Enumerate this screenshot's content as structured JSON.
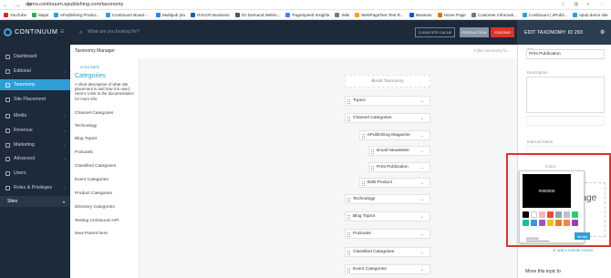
{
  "browser": {
    "url": "demo.continuum.epublishing.com/taxonomy"
  },
  "bookmarks": [
    {
      "label": "YouTube",
      "color": "#e62117"
    },
    {
      "label": "Maps",
      "color": "#34a853"
    },
    {
      "label": "ePublishing Produc...",
      "color": "#2f9ed6"
    },
    {
      "label": "Continuum Board -...",
      "color": "#2f9ed6"
    },
    {
      "label": "Multipub jira",
      "color": "#2684ff"
    },
    {
      "label": "HVACR Business",
      "color": "#1d5fa3"
    },
    {
      "label": "On Demand Webin...",
      "color": "#555"
    },
    {
      "label": "PageSpeed Insights",
      "color": "#4285f4"
    },
    {
      "label": "Wiki",
      "color": "#777"
    },
    {
      "label": "WebPageTest Test R...",
      "color": "#f4a11b"
    },
    {
      "label": "Measure",
      "color": "#0b57d0"
    },
    {
      "label": "Home Page",
      "color": "#e37400"
    },
    {
      "label": "Customer Informati...",
      "color": "#777"
    },
    {
      "label": "Continuum | ePubli...",
      "color": "#2f9ed6"
    },
    {
      "label": "epub demo site",
      "color": "#2f9ed6"
    }
  ],
  "app": {
    "name": "CONTINUUM"
  },
  "sidebar": {
    "items": [
      "Dashboard",
      "Editorial",
      "Taxonomy",
      "Site Placement",
      "Media",
      "Revenue",
      "Marketing",
      "Advanced",
      "Users",
      "Roles & Privileges"
    ],
    "sites": "Sites"
  },
  "topbar": {
    "search_placeholder": "What are you looking for?",
    "clear_cache": "CLEAR SITE CACHE",
    "production": "PRODUCTION",
    "staging": "STAGING"
  },
  "taxonomy": {
    "panel_title": "Taxonomy Manager",
    "go_back": "Go back",
    "title": "Categories",
    "description": "A short description of what site placement is and how it is used. Here's a link to the documentation for more info.",
    "categories": [
      "Channel Categories",
      "Technology",
      "Blog Topics",
      "Podcasts",
      "Classified Categories",
      "Event Categories",
      "Product Categories",
      "Directory Categories",
      "Testing Continuum API",
      "New Parent here"
    ],
    "filter_placeholder": "Filter taxonomy fo...",
    "add_label": "Add Taxonomy",
    "tree": [
      {
        "label": "Topics"
      },
      {
        "label": "Channel Categories"
      },
      {
        "label": "ePublishing Magazine"
      },
      {
        "label": "Email Newsletter"
      },
      {
        "label": "Print Publication"
      },
      {
        "label": "B2B Product"
      },
      {
        "label": "Technology"
      },
      {
        "label": "Blog Topics"
      },
      {
        "label": "Podcasts"
      },
      {
        "label": "Classified Categories"
      },
      {
        "label": "Event Categories"
      }
    ]
  },
  "edit": {
    "header": "EDIT TAXONOMY: ID 293",
    "title_label": "Title",
    "title_value": "Print Publication",
    "description_label": "Description",
    "external_id_label": "External ID",
    "internal_name_label": "Internal Name",
    "color_label": "Color",
    "color_value": "#000000",
    "hex_value": "#000000",
    "image_text": "d Image",
    "media_button": "Media",
    "remote_link": "or add a remote source",
    "move_label": "Move this topic to",
    "swatches": [
      "#000000",
      "#ffffff",
      "#f5b7b1",
      "#e74c3c",
      "#95a5a6",
      "#bdc3c7",
      "#2ecc71",
      "#1abc9c",
      "#3498db",
      "#9b59b6",
      "#f1c40f",
      "#e67e22",
      "#ff7f50",
      "#8e44ad"
    ]
  }
}
